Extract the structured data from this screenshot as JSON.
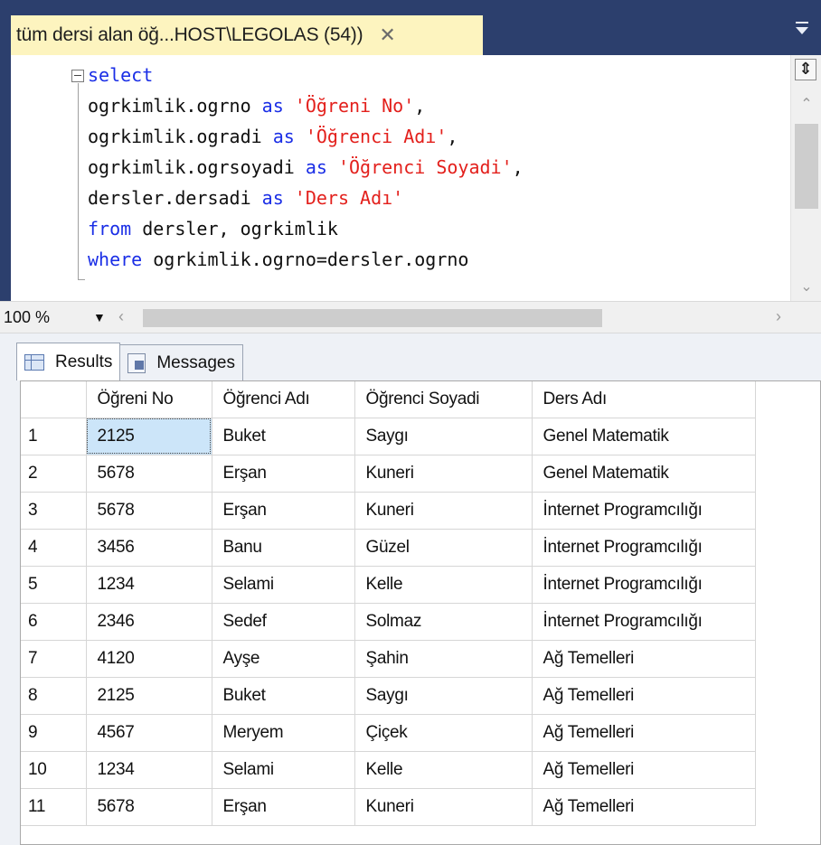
{
  "tab": {
    "title": "tüm dersi alan öğ...HOST\\LEGOLAS (54))",
    "close_glyph": "✕"
  },
  "editor": {
    "lines": {
      "l1_kw": "select",
      "l2_a": "ogrkimlik.ogrno ",
      "l2_kw": "as",
      "l2_str": "'Öğreni No'",
      "l2_end": ",",
      "l3_a": "ogrkimlik.ogradi ",
      "l3_kw": "as",
      "l3_str": "'Öğrenci Adı'",
      "l3_end": ",",
      "l4_a": "ogrkimlik.ogrsoyadi ",
      "l4_kw": "as",
      "l4_str": "'Öğrenci Soyadi'",
      "l4_end": ",",
      "l5_a": "dersler.dersadi ",
      "l5_kw": "as",
      "l5_str": "'Ders Adı'",
      "l6_kw": "from",
      "l6_a": " dersler, ogrkimlik",
      "l7_kw": "where",
      "l7_a": " ogrkimlik.ogrno=dersler.ogrno"
    }
  },
  "zoom": {
    "value": "100 %"
  },
  "results_tabs": {
    "results": "Results",
    "messages": "Messages"
  },
  "grid": {
    "columns": [
      "Öğreni No",
      "Öğrenci Adı",
      "Öğrenci Soyadi",
      "Ders Adı"
    ],
    "rows": [
      {
        "n": "1",
        "no": "2125",
        "ad": "Buket",
        "soyad": "Saygı",
        "ders": "Genel Matematik"
      },
      {
        "n": "2",
        "no": "5678",
        "ad": "Erşan",
        "soyad": "Kuneri",
        "ders": "Genel Matematik"
      },
      {
        "n": "3",
        "no": "5678",
        "ad": "Erşan",
        "soyad": "Kuneri",
        "ders": "İnternet Programcılığı"
      },
      {
        "n": "4",
        "no": "3456",
        "ad": "Banu",
        "soyad": "Güzel",
        "ders": "İnternet Programcılığı"
      },
      {
        "n": "5",
        "no": "1234",
        "ad": "Selami",
        "soyad": "Kelle",
        "ders": "İnternet Programcılığı"
      },
      {
        "n": "6",
        "no": "2346",
        "ad": "Sedef",
        "soyad": "Solmaz",
        "ders": "İnternet Programcılığı"
      },
      {
        "n": "7",
        "no": "4120",
        "ad": "Ayşe",
        "soyad": "Şahin",
        "ders": "Ağ Temelleri"
      },
      {
        "n": "8",
        "no": "2125",
        "ad": "Buket",
        "soyad": "Saygı",
        "ders": "Ağ Temelleri"
      },
      {
        "n": "9",
        "no": "4567",
        "ad": "Meryem",
        "soyad": "Çiçek",
        "ders": "Ağ Temelleri"
      },
      {
        "n": "10",
        "no": "1234",
        "ad": "Selami",
        "soyad": "Kelle",
        "ders": "Ağ Temelleri"
      },
      {
        "n": "11",
        "no": "5678",
        "ad": "Erşan",
        "soyad": "Kuneri",
        "ders": "Ağ Temelleri"
      }
    ]
  },
  "colors": {
    "keyword": "#1a2ee6",
    "string": "#e3201c",
    "tab_bg": "#fdf4bf",
    "frame": "#2c3f6d",
    "selection": "#cce5f9"
  }
}
